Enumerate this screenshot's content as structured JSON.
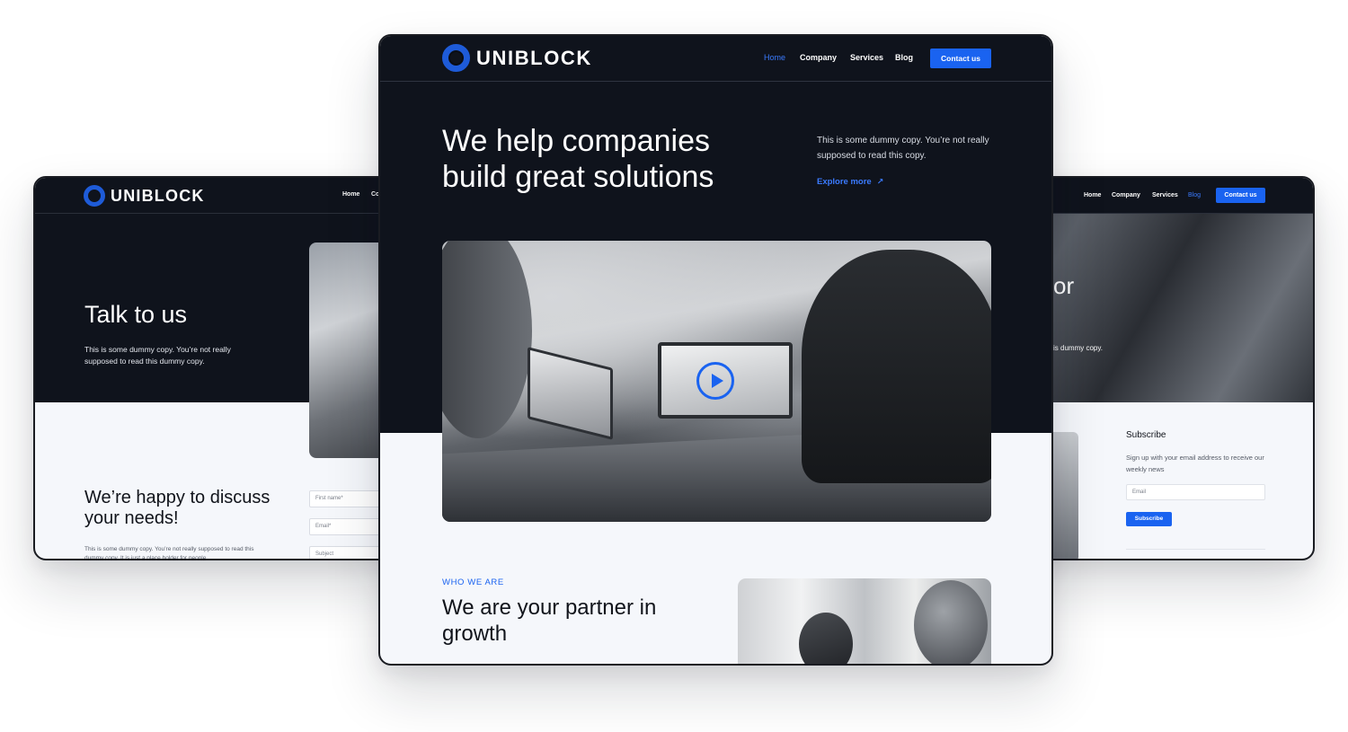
{
  "left_page": {
    "brand": "UNIBLOCK",
    "nav": [
      "Home",
      "Co"
    ],
    "hero_title": "Talk to us",
    "hero_copy": "This is some dummy copy. You’re not really supposed to read this dummy copy.",
    "section_title": "We’re happy to discuss your needs!",
    "section_copy": "This is some dummy copy. You’re not really supposed to read this dummy copy. It is just a place holder for people",
    "form": {
      "first_name_placeholder": "First name*",
      "email_placeholder": "Email*",
      "subject_placeholder": "Subject"
    }
  },
  "center_page": {
    "brand": "UNIBLOCK",
    "nav": {
      "home": "Home",
      "company": "Company",
      "services": "Services",
      "blog": "Blog",
      "cta": "Contact us"
    },
    "hero_title": "We help companies build great solutions",
    "hero_copy": "This is some dummy copy. You’re not really supposed to read this copy.",
    "explore_label": "Explore more",
    "eyebrow": "WHO WE ARE",
    "section_title": "We are your partner in growth"
  },
  "right_page": {
    "nav": {
      "home": "Home",
      "company": "Company",
      "services": "Services",
      "blog": "Blog",
      "cta": "Contact us"
    },
    "hero_partial": "or",
    "hero_copy_partial": "is dummy copy.",
    "subscribe": {
      "title": "Subscribe",
      "copy": "Sign up with your email address to receive our weekly news",
      "email_placeholder": "Email",
      "button": "Subscribe"
    }
  },
  "colors": {
    "dark": "#0f131c",
    "accent": "#1a63f0",
    "light": "#f5f7fb"
  },
  "icons": [
    "logo-ring-icon",
    "play-icon",
    "arrow-up-right-icon"
  ]
}
